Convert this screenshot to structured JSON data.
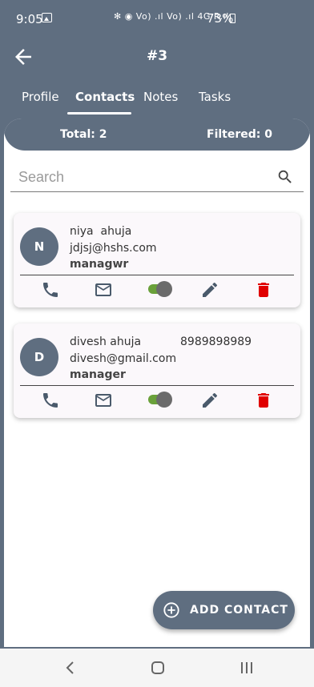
{
  "status": {
    "time": "9:05",
    "network_text": "✻ ◉ Vo) .ıl Vo) .ıl 4G R.ıl",
    "battery": "73%"
  },
  "app_bar": {
    "title": "#3",
    "back_icon": "arrow-left-icon"
  },
  "tabs": [
    {
      "label": "Profile",
      "active": false
    },
    {
      "label": "Contacts",
      "active": true
    },
    {
      "label": "Notes",
      "active": false
    },
    {
      "label": "Tasks",
      "active": false
    }
  ],
  "summary": {
    "total": "Total: 2",
    "filtered": "Filtered: 0"
  },
  "search": {
    "placeholder": "Search",
    "value": ""
  },
  "contacts": [
    {
      "initial": "N",
      "name": "niya  ahuja",
      "phone": "",
      "email": "jdjsj@hshs.com",
      "role": "managwr",
      "active": true
    },
    {
      "initial": "D",
      "name": "divesh ahuja",
      "phone": "8989898989",
      "email": "divesh@gmail.com",
      "role": "manager",
      "active": true
    }
  ],
  "fab": {
    "label": "ADD CONTACT",
    "icon": "add-circle-icon"
  },
  "colors": {
    "primary": "#5f6e80",
    "toggle_on": "#6aa13a",
    "delete": "#e00000",
    "icon": "#4a5a6b"
  }
}
